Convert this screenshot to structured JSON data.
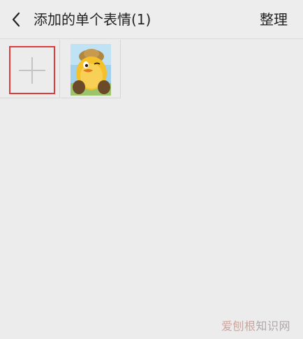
{
  "header": {
    "back_icon": "chevron-left-icon",
    "title": "添加的单个表情(1)",
    "organize_label": "整理"
  },
  "grid": {
    "add_icon": "plus-icon",
    "stickers": [
      {
        "icon": "yellow-chick-sticker"
      }
    ]
  },
  "watermark": {
    "brand": "爱刨根",
    "suffix": "知识网"
  },
  "colors": {
    "background": "#ececec",
    "highlight_border": "#e03b3b"
  }
}
